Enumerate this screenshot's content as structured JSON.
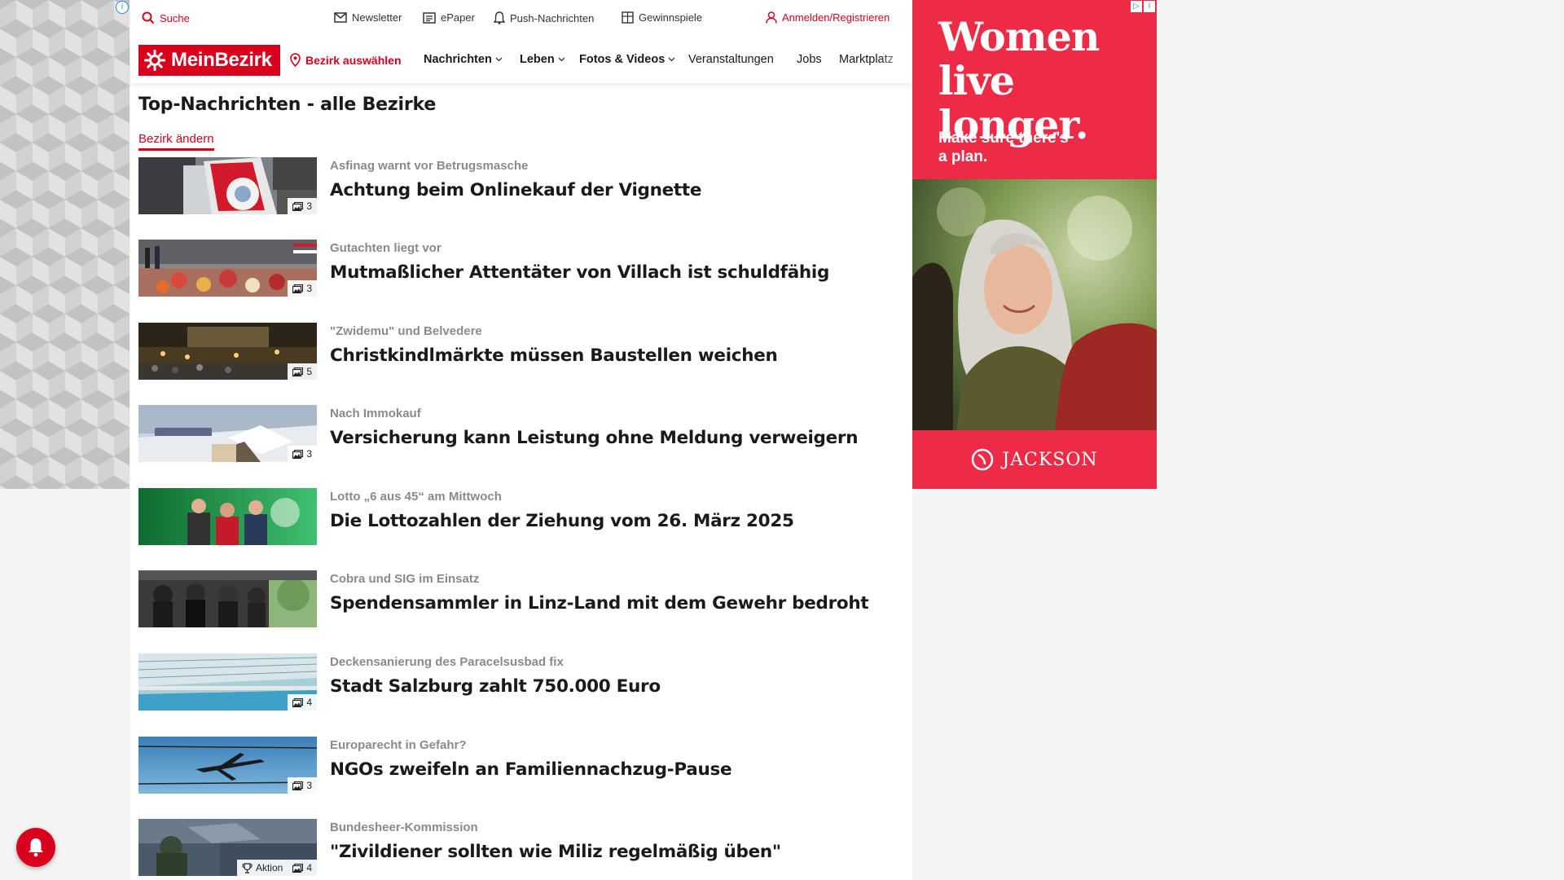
{
  "utility": {
    "search": "Suche",
    "newsletter": "Newsletter",
    "epaper": "ePaper",
    "push": "Push-Nachrichten",
    "contests": "Gewinnspiele",
    "login": "Anmelden/Registrieren"
  },
  "nav": {
    "logo": "MeinBezirk",
    "location": "Bezirk auswählen",
    "items": [
      {
        "label": "Nachrichten",
        "dropdown": true
      },
      {
        "label": "Leben",
        "dropdown": true
      },
      {
        "label": "Fotos & Videos",
        "dropdown": true
      },
      {
        "label": "Veranstaltungen",
        "dropdown": false
      },
      {
        "label": "Jobs",
        "dropdown": false
      },
      {
        "label": "Marktplatz",
        "dropdown": false
      }
    ]
  },
  "page": {
    "title": "Top-Nachrichten - alle Bezirke",
    "change_link": "Bezirk ändern"
  },
  "articles": [
    {
      "kicker": "Asfinag warnt vor Betrugsmasche",
      "headline": "Achtung beim Onlinekauf der Vignette",
      "photos": "3"
    },
    {
      "kicker": "Gutachten liegt vor",
      "headline": "Mutmaßlicher Attentäter von Villach ist schuldfähig",
      "photos": "3"
    },
    {
      "kicker": "\"Zwidemu\" und Belvedere",
      "headline": "Christkindlmärkte müssen Baustellen weichen",
      "photos": "5"
    },
    {
      "kicker": "Nach Immokauf",
      "headline": "Versicherung kann Leistung ohne Meldung verweigern",
      "photos": "3"
    },
    {
      "kicker": "Lotto „6 aus 45“ am Mittwoch",
      "headline": "Die Lottozahlen der Ziehung vom 26. März 2025",
      "photos": ""
    },
    {
      "kicker": "Cobra und SIG im Einsatz",
      "headline": "Spendensammler in Linz-Land mit dem Gewehr bedroht",
      "photos": ""
    },
    {
      "kicker": "Deckensanierung des Paracelsusbad fix",
      "headline": "Stadt Salzburg zahlt 750.000 Euro",
      "photos": "4"
    },
    {
      "kicker": "Europarecht in Gefahr?",
      "headline": "NGOs zweifeln an Familiennachzug-Pause",
      "photos": "3"
    },
    {
      "kicker": "Bundesheer-Kommission",
      "headline": "\"Zivildiener sollten wie Miliz regelmäßig üben\"",
      "photos": "4",
      "tag": "Aktion"
    }
  ],
  "ad": {
    "headline": "Women live longer.",
    "sub": "Make sure there's a plan.",
    "brand": "JACKSON",
    "colors": {
      "background": "#ee2b47"
    }
  },
  "colors": {
    "brand": "#d9001d"
  }
}
